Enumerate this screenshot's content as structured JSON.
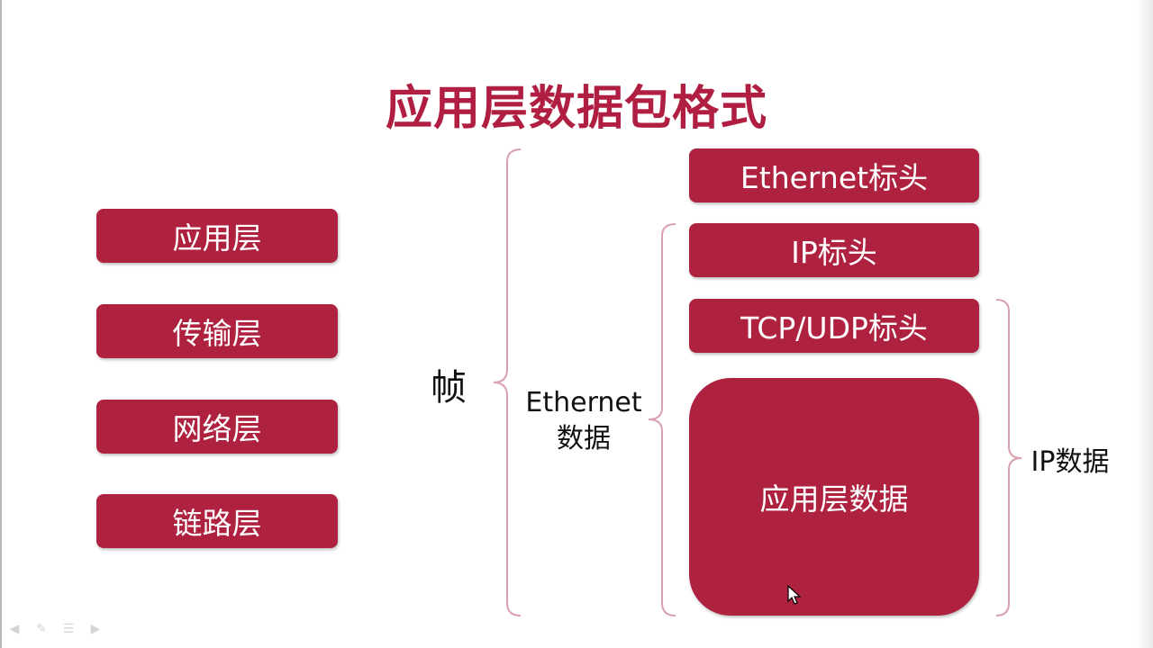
{
  "title": "应用层数据包格式",
  "layers": [
    {
      "label": "应用层"
    },
    {
      "label": "传输层"
    },
    {
      "label": "网络层"
    },
    {
      "label": "链路层"
    }
  ],
  "frame_label": "帧",
  "ethernet_data_label": [
    "Ethernet",
    "数据"
  ],
  "ip_data_label": "IP数据",
  "packet": {
    "ethernet_header": "Ethernet标头",
    "ip_header": "IP标头",
    "tcp_udp_header": "TCP/UDP标头",
    "application_data": "应用层数据"
  },
  "colors": {
    "accent": "#ae2240",
    "title": "#b01f41",
    "brace": "#d9a1ad"
  },
  "toolbar_icons": [
    "arrow-left-icon",
    "pen-icon",
    "menu-icon",
    "arrow-right-icon"
  ]
}
